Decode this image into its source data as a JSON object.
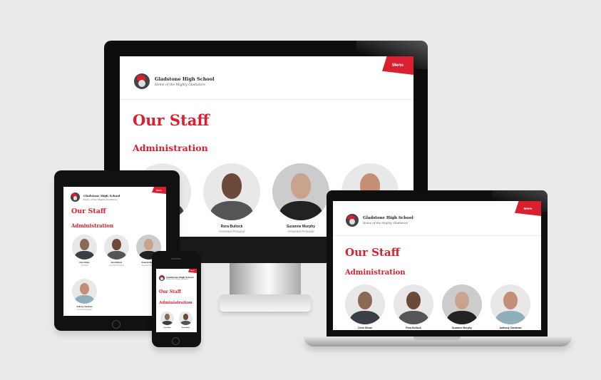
{
  "site": {
    "school_name": "Gladstone High School",
    "tagline": "Home of the Mighty Gladiators",
    "menu_label": "Menu",
    "page_title": "Our Staff",
    "section_title": "Administration"
  },
  "staff": [
    {
      "name": "Chris Silvas",
      "role": "Principal",
      "phone": "",
      "email": ""
    },
    {
      "name": "Rora Bullock",
      "role": "Assistant Principal",
      "phone": ""
    },
    {
      "name": "Suzanne Murphy",
      "role": "Assistant Principal",
      "phone": ""
    },
    {
      "name": "Anthony Cardenas",
      "role": "Assistant Principal",
      "phone": ""
    }
  ],
  "colors": {
    "accent": "#d92030",
    "background": "#eaeaea",
    "device_frame": "#111111"
  }
}
